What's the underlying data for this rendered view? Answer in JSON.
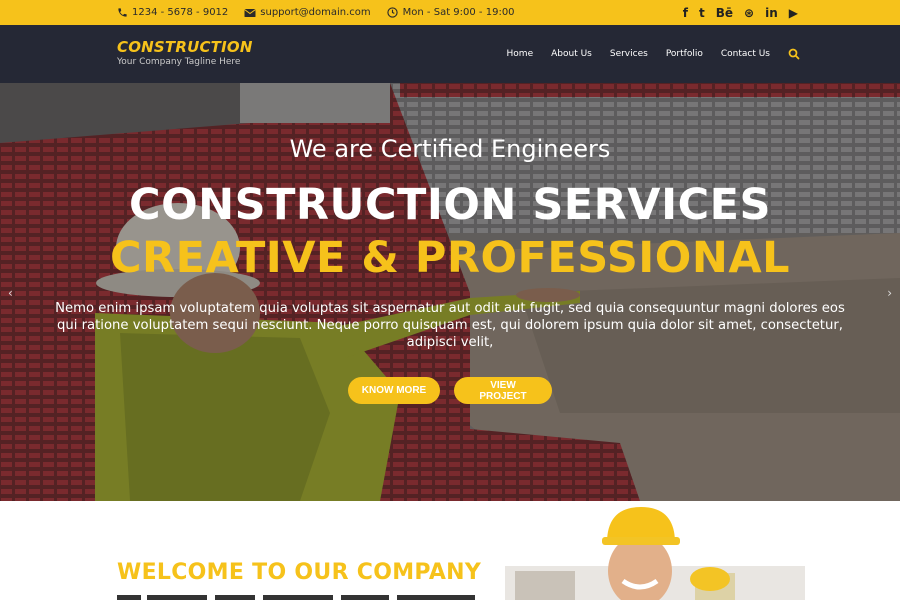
{
  "topbar": {
    "phone": "1234 - 5678 - 9012",
    "email": "support@domain.com",
    "hours": "Mon - Sat 9:00 - 19:00",
    "social": [
      "f",
      "t",
      "Bē",
      "⊛",
      "in",
      "▶"
    ]
  },
  "header": {
    "logo_title": "CONSTRUCTION",
    "logo_tagline": "Your Company Tagline Here",
    "nav": [
      "Home",
      "About Us",
      "Services",
      "Portfolio",
      "Contact Us"
    ]
  },
  "hero": {
    "subtitle": "We are Certified Engineers",
    "title_line1": "CONSTRUCTION SERVICES",
    "title_line2": "CREATIVE & PROFESSIONAL",
    "text": "Nemo enim ipsam voluptatem quia voluptas sit aspernatur aut odit aut fugit, sed quia consequuntur magni dolores eos qui ratione voluptatem sequi nesciunt. Neque porro quisquam est, qui dolorem ipsum quia dolor sit amet, consectetur, adipisci velit,",
    "button_primary": "KNOW MORE",
    "button_secondary": "VIEW PROJECT",
    "arrow_prev": "‹",
    "arrow_next": "›"
  },
  "welcome": {
    "title": "WELCOME TO OUR COMPANY"
  },
  "colors": {
    "accent": "#f6c21b",
    "header_bg": "#252835"
  }
}
